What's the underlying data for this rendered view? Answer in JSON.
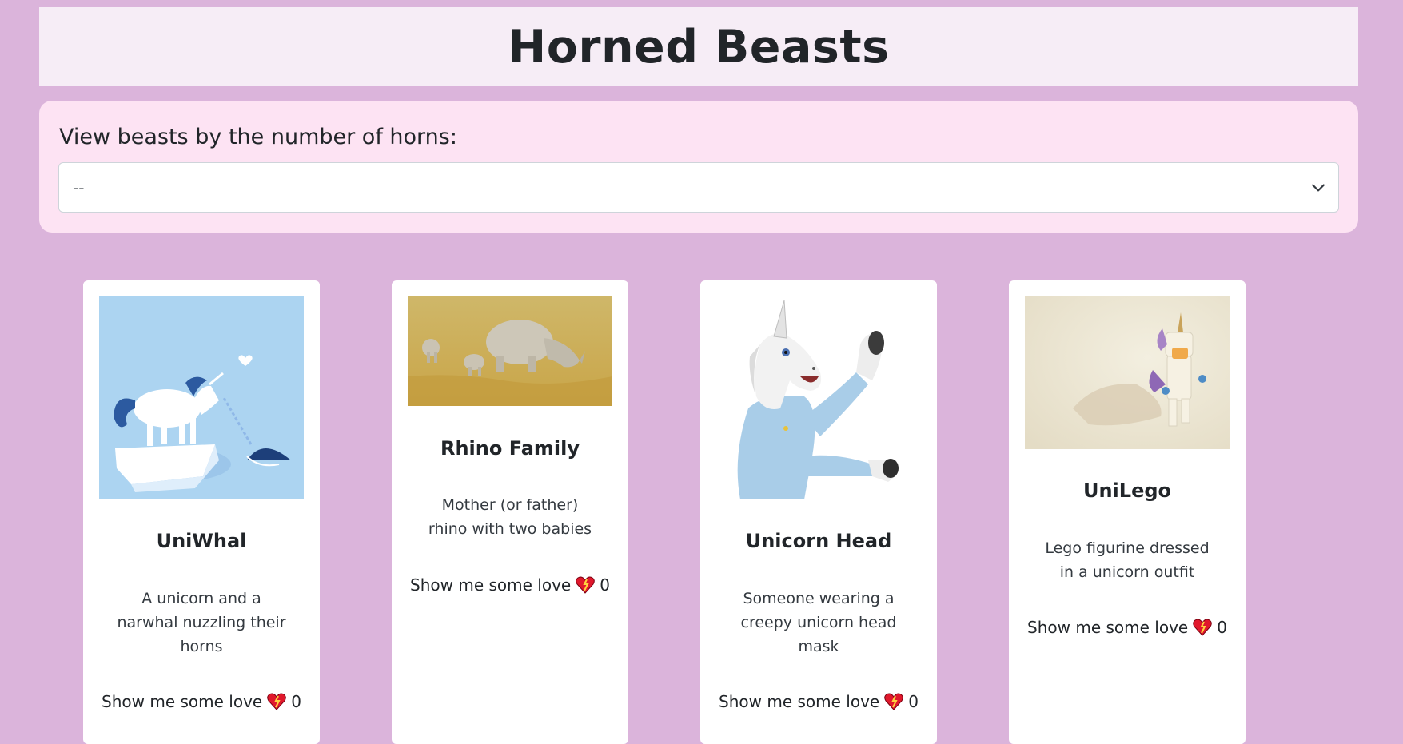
{
  "header": {
    "title": "Horned Beasts"
  },
  "filter": {
    "label": "View beasts by the number of horns:",
    "selected": "--"
  },
  "cards": [
    {
      "title": "UniWhal",
      "description": "A unicorn and a narwhal nuzzling their horns",
      "love_label": "Show me some love",
      "love_count": "0",
      "image": "unicorn-narwhal-illustration"
    },
    {
      "title": "Rhino Family",
      "description": "Mother (or father) rhino with two babies",
      "love_label": "Show me some love",
      "love_count": "0",
      "image": "rhino-family-photo"
    },
    {
      "title": "Unicorn Head",
      "description": "Someone wearing a creepy unicorn head mask",
      "love_label": "Show me some love",
      "love_count": "0",
      "image": "unicorn-head-mask-photo"
    },
    {
      "title": "UniLego",
      "description": "Lego figurine dressed in a unicorn outfit",
      "love_label": "Show me some love",
      "love_count": "0",
      "image": "lego-unicorn-photo"
    }
  ],
  "colors": {
    "background": "#dbb4db",
    "header": "#f6edf6",
    "filter_panel": "#fde3f3",
    "heart": "#e0182c"
  }
}
